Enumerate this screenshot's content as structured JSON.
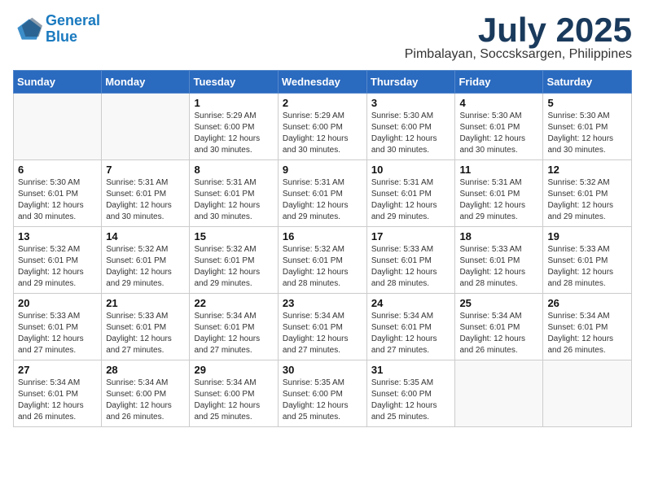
{
  "header": {
    "logo_line1": "General",
    "logo_line2": "Blue",
    "month_year": "July 2025",
    "location": "Pimbalayan, Soccsksargen, Philippines"
  },
  "weekdays": [
    "Sunday",
    "Monday",
    "Tuesday",
    "Wednesday",
    "Thursday",
    "Friday",
    "Saturday"
  ],
  "weeks": [
    [
      {
        "day": "",
        "sunrise": "",
        "sunset": "",
        "daylight": ""
      },
      {
        "day": "",
        "sunrise": "",
        "sunset": "",
        "daylight": ""
      },
      {
        "day": "1",
        "sunrise": "Sunrise: 5:29 AM",
        "sunset": "Sunset: 6:00 PM",
        "daylight": "Daylight: 12 hours and 30 minutes."
      },
      {
        "day": "2",
        "sunrise": "Sunrise: 5:29 AM",
        "sunset": "Sunset: 6:00 PM",
        "daylight": "Daylight: 12 hours and 30 minutes."
      },
      {
        "day": "3",
        "sunrise": "Sunrise: 5:30 AM",
        "sunset": "Sunset: 6:00 PM",
        "daylight": "Daylight: 12 hours and 30 minutes."
      },
      {
        "day": "4",
        "sunrise": "Sunrise: 5:30 AM",
        "sunset": "Sunset: 6:01 PM",
        "daylight": "Daylight: 12 hours and 30 minutes."
      },
      {
        "day": "5",
        "sunrise": "Sunrise: 5:30 AM",
        "sunset": "Sunset: 6:01 PM",
        "daylight": "Daylight: 12 hours and 30 minutes."
      }
    ],
    [
      {
        "day": "6",
        "sunrise": "Sunrise: 5:30 AM",
        "sunset": "Sunset: 6:01 PM",
        "daylight": "Daylight: 12 hours and 30 minutes."
      },
      {
        "day": "7",
        "sunrise": "Sunrise: 5:31 AM",
        "sunset": "Sunset: 6:01 PM",
        "daylight": "Daylight: 12 hours and 30 minutes."
      },
      {
        "day": "8",
        "sunrise": "Sunrise: 5:31 AM",
        "sunset": "Sunset: 6:01 PM",
        "daylight": "Daylight: 12 hours and 30 minutes."
      },
      {
        "day": "9",
        "sunrise": "Sunrise: 5:31 AM",
        "sunset": "Sunset: 6:01 PM",
        "daylight": "Daylight: 12 hours and 29 minutes."
      },
      {
        "day": "10",
        "sunrise": "Sunrise: 5:31 AM",
        "sunset": "Sunset: 6:01 PM",
        "daylight": "Daylight: 12 hours and 29 minutes."
      },
      {
        "day": "11",
        "sunrise": "Sunrise: 5:31 AM",
        "sunset": "Sunset: 6:01 PM",
        "daylight": "Daylight: 12 hours and 29 minutes."
      },
      {
        "day": "12",
        "sunrise": "Sunrise: 5:32 AM",
        "sunset": "Sunset: 6:01 PM",
        "daylight": "Daylight: 12 hours and 29 minutes."
      }
    ],
    [
      {
        "day": "13",
        "sunrise": "Sunrise: 5:32 AM",
        "sunset": "Sunset: 6:01 PM",
        "daylight": "Daylight: 12 hours and 29 minutes."
      },
      {
        "day": "14",
        "sunrise": "Sunrise: 5:32 AM",
        "sunset": "Sunset: 6:01 PM",
        "daylight": "Daylight: 12 hours and 29 minutes."
      },
      {
        "day": "15",
        "sunrise": "Sunrise: 5:32 AM",
        "sunset": "Sunset: 6:01 PM",
        "daylight": "Daylight: 12 hours and 29 minutes."
      },
      {
        "day": "16",
        "sunrise": "Sunrise: 5:32 AM",
        "sunset": "Sunset: 6:01 PM",
        "daylight": "Daylight: 12 hours and 28 minutes."
      },
      {
        "day": "17",
        "sunrise": "Sunrise: 5:33 AM",
        "sunset": "Sunset: 6:01 PM",
        "daylight": "Daylight: 12 hours and 28 minutes."
      },
      {
        "day": "18",
        "sunrise": "Sunrise: 5:33 AM",
        "sunset": "Sunset: 6:01 PM",
        "daylight": "Daylight: 12 hours and 28 minutes."
      },
      {
        "day": "19",
        "sunrise": "Sunrise: 5:33 AM",
        "sunset": "Sunset: 6:01 PM",
        "daylight": "Daylight: 12 hours and 28 minutes."
      }
    ],
    [
      {
        "day": "20",
        "sunrise": "Sunrise: 5:33 AM",
        "sunset": "Sunset: 6:01 PM",
        "daylight": "Daylight: 12 hours and 27 minutes."
      },
      {
        "day": "21",
        "sunrise": "Sunrise: 5:33 AM",
        "sunset": "Sunset: 6:01 PM",
        "daylight": "Daylight: 12 hours and 27 minutes."
      },
      {
        "day": "22",
        "sunrise": "Sunrise: 5:34 AM",
        "sunset": "Sunset: 6:01 PM",
        "daylight": "Daylight: 12 hours and 27 minutes."
      },
      {
        "day": "23",
        "sunrise": "Sunrise: 5:34 AM",
        "sunset": "Sunset: 6:01 PM",
        "daylight": "Daylight: 12 hours and 27 minutes."
      },
      {
        "day": "24",
        "sunrise": "Sunrise: 5:34 AM",
        "sunset": "Sunset: 6:01 PM",
        "daylight": "Daylight: 12 hours and 27 minutes."
      },
      {
        "day": "25",
        "sunrise": "Sunrise: 5:34 AM",
        "sunset": "Sunset: 6:01 PM",
        "daylight": "Daylight: 12 hours and 26 minutes."
      },
      {
        "day": "26",
        "sunrise": "Sunrise: 5:34 AM",
        "sunset": "Sunset: 6:01 PM",
        "daylight": "Daylight: 12 hours and 26 minutes."
      }
    ],
    [
      {
        "day": "27",
        "sunrise": "Sunrise: 5:34 AM",
        "sunset": "Sunset: 6:01 PM",
        "daylight": "Daylight: 12 hours and 26 minutes."
      },
      {
        "day": "28",
        "sunrise": "Sunrise: 5:34 AM",
        "sunset": "Sunset: 6:00 PM",
        "daylight": "Daylight: 12 hours and 26 minutes."
      },
      {
        "day": "29",
        "sunrise": "Sunrise: 5:34 AM",
        "sunset": "Sunset: 6:00 PM",
        "daylight": "Daylight: 12 hours and 25 minutes."
      },
      {
        "day": "30",
        "sunrise": "Sunrise: 5:35 AM",
        "sunset": "Sunset: 6:00 PM",
        "daylight": "Daylight: 12 hours and 25 minutes."
      },
      {
        "day": "31",
        "sunrise": "Sunrise: 5:35 AM",
        "sunset": "Sunset: 6:00 PM",
        "daylight": "Daylight: 12 hours and 25 minutes."
      },
      {
        "day": "",
        "sunrise": "",
        "sunset": "",
        "daylight": ""
      },
      {
        "day": "",
        "sunrise": "",
        "sunset": "",
        "daylight": ""
      }
    ]
  ]
}
